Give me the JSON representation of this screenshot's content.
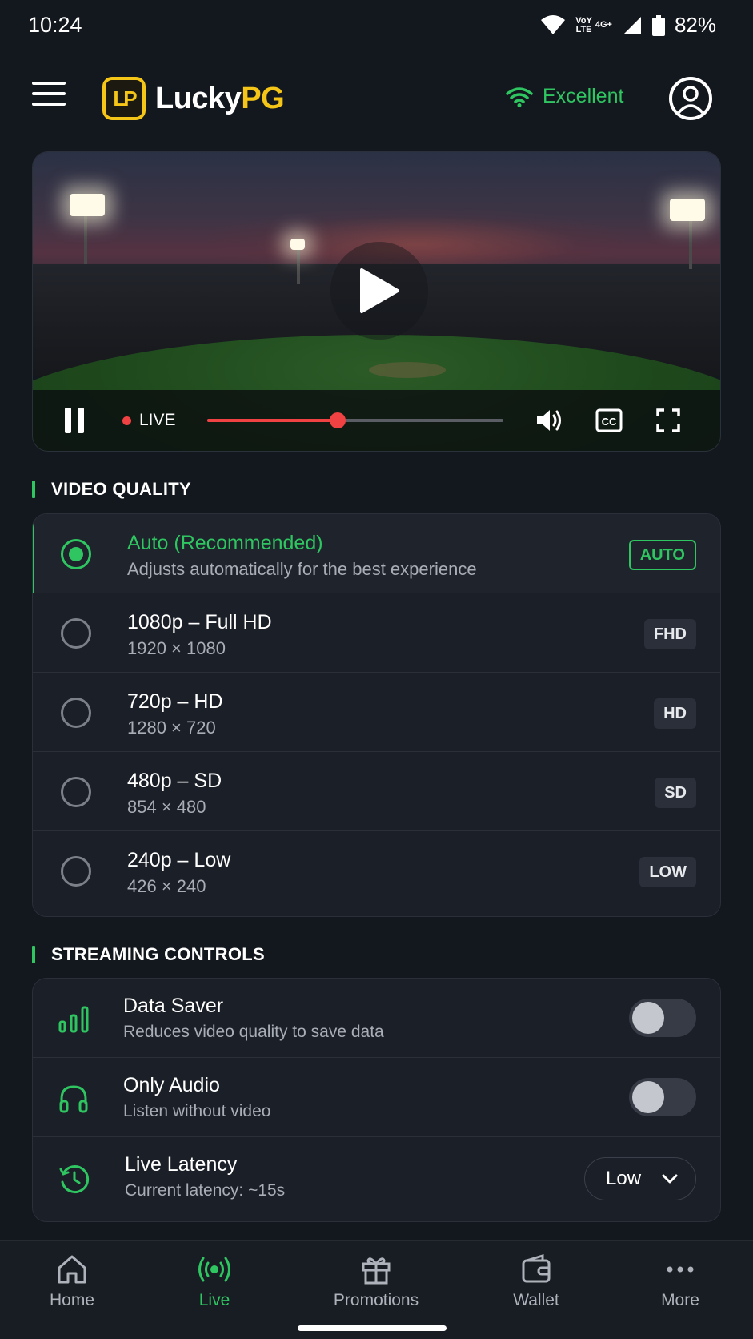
{
  "status_bar": {
    "time": "10:24",
    "battery": "82%",
    "net_top": "VoY",
    "net_bottom": "LTE",
    "net_type": "4G+"
  },
  "header": {
    "logo_mark": "LP",
    "logo_name_part1": "Lucky",
    "logo_name_part2": "PG",
    "connection_label": "Excellent",
    "icons": [
      "menu-icon",
      "wifi-icon",
      "profile-icon"
    ]
  },
  "player": {
    "live_label": "LIVE",
    "progress": 0.44,
    "icons": [
      "play-icon",
      "pause-icon",
      "volume-icon",
      "cc-icon",
      "fullscreen-icon"
    ]
  },
  "video_quality": {
    "title": "VIDEO QUALITY",
    "options": [
      {
        "title": "Auto (Recommended)",
        "subtitle": "Adjusts automatically for the best experience",
        "badge": "AUTO",
        "selected": true
      },
      {
        "title": "1080p – Full HD",
        "subtitle": "1920 × 1080",
        "badge": "FHD",
        "selected": false
      },
      {
        "title": "720p – HD",
        "subtitle": "1280 × 720",
        "badge": "HD",
        "selected": false
      },
      {
        "title": "480p – SD",
        "subtitle": "854 × 480",
        "badge": "SD",
        "selected": false
      },
      {
        "title": "240p – Low",
        "subtitle": "426 × 240",
        "badge": "LOW",
        "selected": false
      }
    ]
  },
  "streaming_controls": {
    "title": "STREAMING CONTROLS",
    "data_saver": {
      "title": "Data Saver",
      "subtitle": "Reduces video quality to save data",
      "enabled": false,
      "icon": "bar-chart-icon"
    },
    "only_audio": {
      "title": "Only Audio",
      "subtitle": "Listen without video",
      "enabled": false,
      "icon": "headphones-icon"
    },
    "live_latency": {
      "title": "Live Latency",
      "subtitle": "Current latency: ~15s",
      "value": "Low",
      "icon": "clock-icon"
    }
  },
  "bottom_nav": {
    "items": [
      {
        "label": "Home",
        "icon": "home-icon",
        "active": false
      },
      {
        "label": "Live",
        "icon": "broadcast-icon",
        "active": true
      },
      {
        "label": "Promotions",
        "icon": "gift-icon",
        "active": false
      },
      {
        "label": "Wallet",
        "icon": "wallet-icon",
        "active": false
      },
      {
        "label": "More",
        "icon": "more-icon",
        "active": false
      }
    ]
  },
  "colors": {
    "accent": "#2fc561",
    "brand": "#f5c518",
    "live": "#f04242",
    "background": "#13171e",
    "card": "#1b1f27"
  }
}
